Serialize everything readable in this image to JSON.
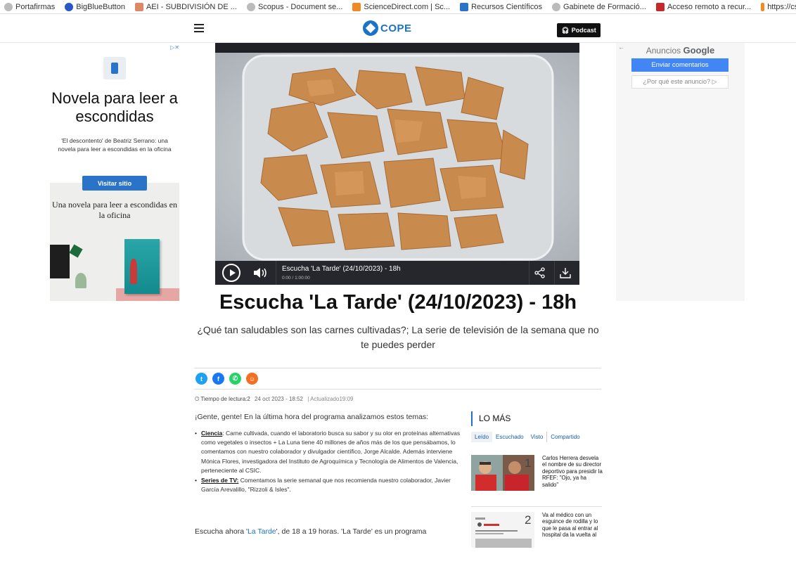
{
  "bookmarks": [
    {
      "label": "Portafirmas",
      "color": "#888888"
    },
    {
      "label": "BigBlueButton",
      "color": "#2a56c6"
    },
    {
      "label": "AEI - SUBDIVISIÓN DE ...",
      "color": "#c44"
    },
    {
      "label": "Scopus - Document se...",
      "color": "#888888"
    },
    {
      "label": "ScienceDirect.com | Sc...",
      "color": "#f08a24"
    },
    {
      "label": "Recursos Científicos",
      "color": "#2a73c9"
    },
    {
      "label": "Gabinete de Formació...",
      "color": "#888888"
    },
    {
      "label": "Acceso remoto a recur...",
      "color": "#c4282a"
    },
    {
      "label": "https://csic-primo.ho",
      "color": "#f08a24"
    }
  ],
  "header": {
    "logo_text": "COPE",
    "podcast_label": "Podcast"
  },
  "ad_left": {
    "title": "Novela para leer a escondidas",
    "description": "'El descontento' de Beatriz Serrano: una novela para leer a escondidas en la oficina",
    "visit_label": "Visitar sitio",
    "banner_text": "Una novela para leer a escondidas en la oficina"
  },
  "ad_right": {
    "ads_by": "Anuncios",
    "google": "Google",
    "send_feedback": "Enviar comentarios",
    "why_ad": "¿Por qué este anuncio? ▷"
  },
  "player": {
    "title": "Escucha 'La Tarde' (24/10/2023) - 18h",
    "time": "0:00 / 1:00:00"
  },
  "article": {
    "headline": "Escucha 'La Tarde' (24/10/2023) - 18h",
    "subtitle": "¿Qué tan saludables son las carnes cultivadas?; La serie de televisión de la semana que no te puedes perder",
    "reading_time": "Tiempo de lectura:2",
    "date": "24 oct 2023 - 18:52",
    "updated": "| Actualizado19:09",
    "intro": "¡Gente, gente! En la última hora del programa analizamos estos temas:",
    "bullet1_label": "Ciencia",
    "bullet1_text": ": Carne cultivada, cuando el laboratorio busca su sabor y su olor en proteínas alternativas como vegetales o insectos + La Luna tiene 40 millones de años más de los que pensábamos, lo comentamos con nuestro colaborador y divulgador científico, Jorge Alcalde. Además interviene Mónica Flores, investigadora del Instituto de Agroquímica y Tecnología de Alimentos de Valencia, perteneciente al CSIC.",
    "bullet2_label": "Series de TV:",
    "bullet2_text": " Comentamos la serie semanal que nos recomienda nuestro colaborador, Javier García Arevalillo, \"Rizzoli & Isles\".",
    "outro_pre": "Escucha ahora '",
    "outro_link": "La Tarde",
    "outro_post": "', de 18 a 19 horas. 'La Tarde' es un programa"
  },
  "lo_mas": {
    "title": "LO MÁS",
    "tabs": [
      "Leído",
      "Escuchado",
      "Visto",
      "Compartido"
    ],
    "items": [
      {
        "rank": "1",
        "text": "Carlos Herrera desvela el nombre de su director deportivo para presidir la RFEF: \"Ojo, ya ha salido\""
      },
      {
        "rank": "2",
        "text": "Va al médico con un esguince de rodilla y lo que le pasa al entrar al hospital da la vuelta al"
      }
    ]
  }
}
